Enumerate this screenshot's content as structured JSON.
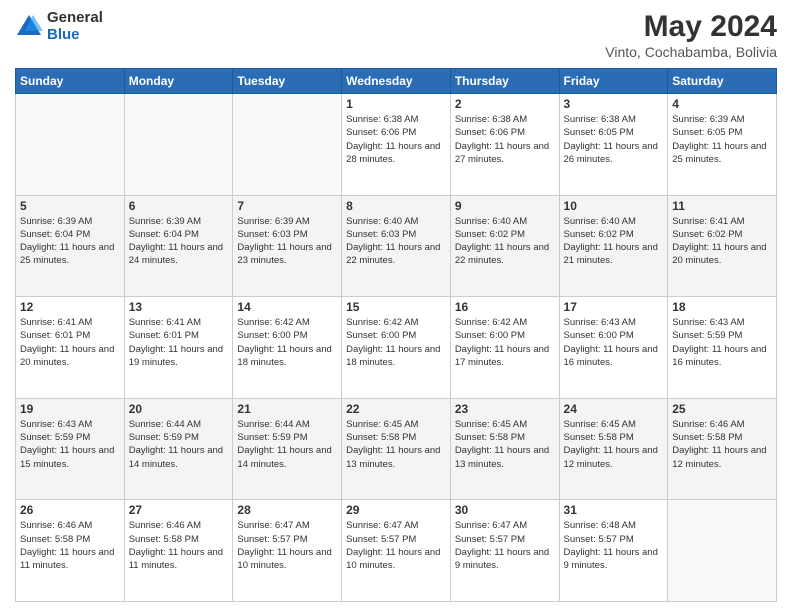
{
  "header": {
    "logo_general": "General",
    "logo_blue": "Blue",
    "title": "May 2024",
    "subtitle": "Vinto, Cochabamba, Bolivia"
  },
  "weekdays": [
    "Sunday",
    "Monday",
    "Tuesday",
    "Wednesday",
    "Thursday",
    "Friday",
    "Saturday"
  ],
  "weeks": [
    [
      {
        "num": "",
        "info": ""
      },
      {
        "num": "",
        "info": ""
      },
      {
        "num": "",
        "info": ""
      },
      {
        "num": "1",
        "info": "Sunrise: 6:38 AM\nSunset: 6:06 PM\nDaylight: 11 hours\nand 28 minutes."
      },
      {
        "num": "2",
        "info": "Sunrise: 6:38 AM\nSunset: 6:06 PM\nDaylight: 11 hours\nand 27 minutes."
      },
      {
        "num": "3",
        "info": "Sunrise: 6:38 AM\nSunset: 6:05 PM\nDaylight: 11 hours\nand 26 minutes."
      },
      {
        "num": "4",
        "info": "Sunrise: 6:39 AM\nSunset: 6:05 PM\nDaylight: 11 hours\nand 25 minutes."
      }
    ],
    [
      {
        "num": "5",
        "info": "Sunrise: 6:39 AM\nSunset: 6:04 PM\nDaylight: 11 hours\nand 25 minutes."
      },
      {
        "num": "6",
        "info": "Sunrise: 6:39 AM\nSunset: 6:04 PM\nDaylight: 11 hours\nand 24 minutes."
      },
      {
        "num": "7",
        "info": "Sunrise: 6:39 AM\nSunset: 6:03 PM\nDaylight: 11 hours\nand 23 minutes."
      },
      {
        "num": "8",
        "info": "Sunrise: 6:40 AM\nSunset: 6:03 PM\nDaylight: 11 hours\nand 22 minutes."
      },
      {
        "num": "9",
        "info": "Sunrise: 6:40 AM\nSunset: 6:02 PM\nDaylight: 11 hours\nand 22 minutes."
      },
      {
        "num": "10",
        "info": "Sunrise: 6:40 AM\nSunset: 6:02 PM\nDaylight: 11 hours\nand 21 minutes."
      },
      {
        "num": "11",
        "info": "Sunrise: 6:41 AM\nSunset: 6:02 PM\nDaylight: 11 hours\nand 20 minutes."
      }
    ],
    [
      {
        "num": "12",
        "info": "Sunrise: 6:41 AM\nSunset: 6:01 PM\nDaylight: 11 hours\nand 20 minutes."
      },
      {
        "num": "13",
        "info": "Sunrise: 6:41 AM\nSunset: 6:01 PM\nDaylight: 11 hours\nand 19 minutes."
      },
      {
        "num": "14",
        "info": "Sunrise: 6:42 AM\nSunset: 6:00 PM\nDaylight: 11 hours\nand 18 minutes."
      },
      {
        "num": "15",
        "info": "Sunrise: 6:42 AM\nSunset: 6:00 PM\nDaylight: 11 hours\nand 18 minutes."
      },
      {
        "num": "16",
        "info": "Sunrise: 6:42 AM\nSunset: 6:00 PM\nDaylight: 11 hours\nand 17 minutes."
      },
      {
        "num": "17",
        "info": "Sunrise: 6:43 AM\nSunset: 6:00 PM\nDaylight: 11 hours\nand 16 minutes."
      },
      {
        "num": "18",
        "info": "Sunrise: 6:43 AM\nSunset: 5:59 PM\nDaylight: 11 hours\nand 16 minutes."
      }
    ],
    [
      {
        "num": "19",
        "info": "Sunrise: 6:43 AM\nSunset: 5:59 PM\nDaylight: 11 hours\nand 15 minutes."
      },
      {
        "num": "20",
        "info": "Sunrise: 6:44 AM\nSunset: 5:59 PM\nDaylight: 11 hours\nand 14 minutes."
      },
      {
        "num": "21",
        "info": "Sunrise: 6:44 AM\nSunset: 5:59 PM\nDaylight: 11 hours\nand 14 minutes."
      },
      {
        "num": "22",
        "info": "Sunrise: 6:45 AM\nSunset: 5:58 PM\nDaylight: 11 hours\nand 13 minutes."
      },
      {
        "num": "23",
        "info": "Sunrise: 6:45 AM\nSunset: 5:58 PM\nDaylight: 11 hours\nand 13 minutes."
      },
      {
        "num": "24",
        "info": "Sunrise: 6:45 AM\nSunset: 5:58 PM\nDaylight: 11 hours\nand 12 minutes."
      },
      {
        "num": "25",
        "info": "Sunrise: 6:46 AM\nSunset: 5:58 PM\nDaylight: 11 hours\nand 12 minutes."
      }
    ],
    [
      {
        "num": "26",
        "info": "Sunrise: 6:46 AM\nSunset: 5:58 PM\nDaylight: 11 hours\nand 11 minutes."
      },
      {
        "num": "27",
        "info": "Sunrise: 6:46 AM\nSunset: 5:58 PM\nDaylight: 11 hours\nand 11 minutes."
      },
      {
        "num": "28",
        "info": "Sunrise: 6:47 AM\nSunset: 5:57 PM\nDaylight: 11 hours\nand 10 minutes."
      },
      {
        "num": "29",
        "info": "Sunrise: 6:47 AM\nSunset: 5:57 PM\nDaylight: 11 hours\nand 10 minutes."
      },
      {
        "num": "30",
        "info": "Sunrise: 6:47 AM\nSunset: 5:57 PM\nDaylight: 11 hours\nand 9 minutes."
      },
      {
        "num": "31",
        "info": "Sunrise: 6:48 AM\nSunset: 5:57 PM\nDaylight: 11 hours\nand 9 minutes."
      },
      {
        "num": "",
        "info": ""
      }
    ]
  ]
}
